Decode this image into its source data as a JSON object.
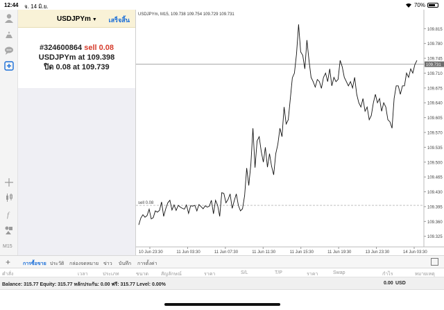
{
  "status_bar": {
    "time": "12:44",
    "date": "จ. 14 มิ.ย.",
    "battery": "70%"
  },
  "left_toolbar": {
    "timeframe": "M15"
  },
  "panel": {
    "symbol": "USDJPYm",
    "done_label": "เสร็จสิ้น",
    "order_id": "#324600864",
    "order_type": "sell 0.08",
    "open_line": "USDJPYm at",
    "open_price": "109.398",
    "close_prefix": "ปิด 0.08 at",
    "close_price": "109.739"
  },
  "chart_header": "USDJPYm, M15, 109.738 109.754 109.729 109.731",
  "order_line_label": "sell 0.08",
  "current_price_label": "109.731",
  "tabs": [
    "การซื้อขาย",
    "ประวัติ",
    "กล่องจดหมาย",
    "ข่าว",
    "บันทึก",
    "การตั้งค่า"
  ],
  "columns": [
    "คำสั่ง",
    "เวลา",
    "ประเภท",
    "ขนาด",
    "สัญลักษณ์",
    "ราคา",
    "S/L",
    "T/P",
    "ราคา",
    "Swap",
    "กำไร",
    "หมายเหตุ"
  ],
  "balance": {
    "text": "Balance: 315.77 Equity: 315.77 หลักประกัน: 0.00 ฟรี: 315.77 Level: 0.00%",
    "profit": "0.00",
    "currency": "USD"
  },
  "colors": {
    "accent": "#1a6ed8",
    "sell": "#d63b2b",
    "panel_header": "#f9f2d7"
  },
  "chart_data": {
    "type": "line",
    "title": "USDJPYm, M15, 109.738 109.754 109.729 109.731",
    "xlabel": "",
    "ylabel": "",
    "ylim": [
      109.3,
      109.84
    ],
    "y_ticks": [
      "109.815",
      "109.780",
      "109.745",
      "109.710",
      "109.675",
      "109.640",
      "109.605",
      "109.570",
      "109.535",
      "109.500",
      "109.465",
      "109.430",
      "109.395",
      "109.360",
      "109.325"
    ],
    "x_ticks": [
      "10 Jun 23:30",
      "11 Jun 03:30",
      "11 Jun 07:30",
      "11 Jun 11:30",
      "11 Jun 15:30",
      "11 Jun 19:30",
      "13 Jun 23:30",
      "14 Jun 03:30"
    ],
    "x": [
      0,
      3,
      6,
      9,
      12,
      15,
      18,
      21,
      24,
      27,
      30,
      33,
      36,
      39,
      42,
      45,
      48,
      51,
      54,
      57,
      60,
      63,
      66,
      69,
      72,
      75,
      78,
      81,
      84,
      87,
      90,
      93,
      96,
      99,
      102,
      105,
      108,
      111,
      114,
      117,
      120,
      123,
      126,
      129,
      132,
      135,
      138,
      141,
      144,
      147,
      150,
      153,
      156,
      159,
      162,
      165,
      168,
      171,
      174,
      177,
      180,
      183,
      186,
      189,
      192,
      195,
      198,
      201,
      204,
      207,
      210,
      213,
      216,
      219,
      222,
      225,
      228,
      231,
      234,
      237,
      240,
      243,
      246,
      249,
      252,
      255,
      258,
      261,
      264,
      267,
      270,
      273,
      276,
      279,
      282,
      285,
      288,
      291,
      294,
      297,
      300,
      303,
      306,
      309,
      312,
      315,
      318,
      321,
      324,
      327,
      330,
      333,
      336,
      339,
      342,
      345,
      348,
      351,
      354,
      357,
      360,
      363,
      366,
      369,
      372,
      375,
      378,
      381,
      384,
      387,
      390,
      393,
      396,
      399,
      402
    ],
    "values": [
      109.352,
      109.368,
      109.376,
      109.37,
      109.374,
      109.389,
      109.366,
      109.369,
      109.385,
      109.382,
      109.386,
      109.406,
      109.372,
      109.39,
      109.404,
      109.41,
      109.387,
      109.399,
      109.386,
      109.398,
      109.394,
      109.391,
      109.389,
      109.399,
      109.379,
      109.397,
      109.396,
      109.398,
      109.385,
      109.4,
      109.395,
      109.39,
      109.397,
      109.394,
      109.396,
      109.41,
      109.378,
      109.41,
      109.398,
      109.372,
      109.428,
      109.426,
      109.404,
      109.412,
      109.425,
      109.391,
      109.409,
      109.425,
      109.398,
      109.385,
      109.39,
      109.421,
      109.486,
      109.445,
      109.495,
      109.58,
      109.487,
      109.55,
      109.56,
      109.525,
      109.5,
      109.535,
      109.488,
      109.52,
      109.49,
      109.47,
      109.52,
      109.542,
      109.58,
      109.56,
      109.63,
      109.59,
      109.6,
      109.65,
      109.699,
      109.71,
      109.755,
      109.825,
      109.76,
      109.752,
      109.72,
      109.788,
      109.74,
      109.7,
      109.69,
      109.677,
      109.695,
      109.69,
      109.674,
      109.7,
      109.71,
      109.69,
      109.72,
      109.68,
      109.7,
      109.69,
      109.695,
      109.74,
      109.725,
      109.7,
      109.69,
      109.68,
      109.69,
      109.675,
      109.7,
      109.66,
      109.64,
      109.63,
      109.65,
      109.62,
      109.63,
      109.6,
      109.61,
      109.64,
      109.66,
      109.64,
      109.65,
      109.62,
      109.64,
      109.63,
      109.6,
      109.595,
      109.58,
      109.65,
      109.68,
      109.68,
      109.66,
      109.68,
      109.68,
      109.71,
      109.7,
      109.72,
      109.71,
      109.73,
      109.74
    ]
  }
}
